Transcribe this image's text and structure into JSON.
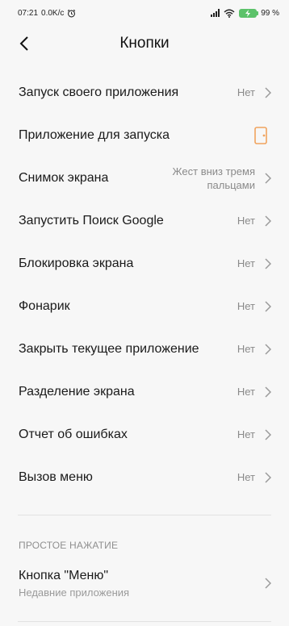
{
  "status": {
    "time": "07:21",
    "speed": "0.0K/c",
    "battery": "99 %"
  },
  "header": {
    "title": "Кнопки"
  },
  "items": [
    {
      "label": "Запуск своего приложения",
      "value": "Нет"
    },
    {
      "label": "Приложение для запуска",
      "value": ""
    },
    {
      "label": "Снимок экрана",
      "value_line1": "Жест вниз тремя",
      "value_line2": "пальцами"
    },
    {
      "label": "Запустить Поиск Google",
      "value": "Нет"
    },
    {
      "label": "Блокировка экрана",
      "value": "Нет"
    },
    {
      "label": "Фонарик",
      "value": "Нет"
    },
    {
      "label": "Закрыть текущее приложение",
      "value": "Нет"
    },
    {
      "label": "Разделение экрана",
      "value": "Нет"
    },
    {
      "label": "Отчет об ошибках",
      "value": "Нет"
    },
    {
      "label": "Вызов меню",
      "value": "Нет"
    }
  ],
  "section": {
    "title": "ПРОСТОЕ НАЖАТИЕ",
    "item": {
      "label": "Кнопка \"Меню\"",
      "subtitle": "Недавние приложения"
    }
  },
  "colors": {
    "accent_icon": "#f0a35e",
    "battery": "#5cc26a"
  }
}
